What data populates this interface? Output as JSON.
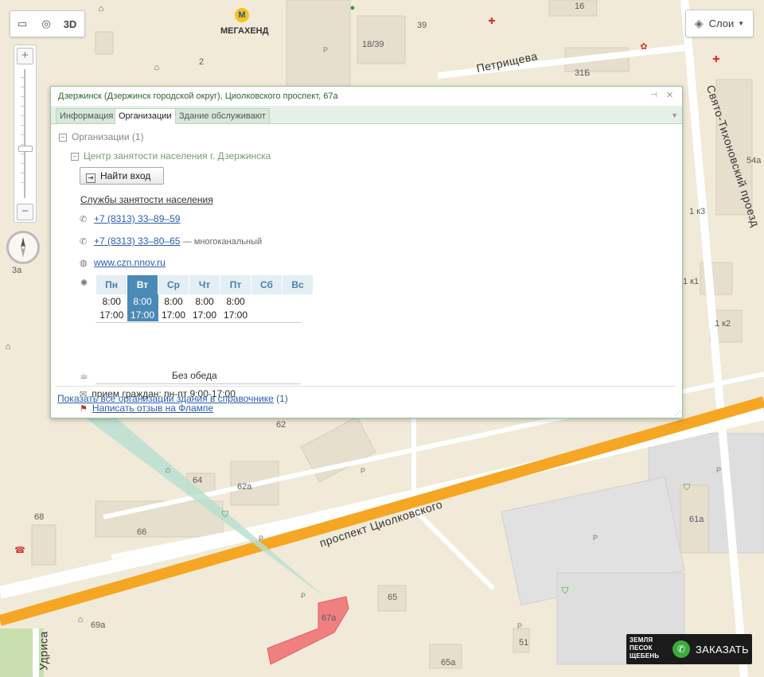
{
  "toolbar": {
    "ruler_icon": "ruler-icon",
    "radius_icon": "radius-icon",
    "label_3d": "3D"
  },
  "zoom": {
    "plus": "+",
    "minus": "−"
  },
  "layers": {
    "label": "Слои"
  },
  "map": {
    "streets": [
      {
        "name": "street-petrishcheva",
        "text": "Петрищева"
      },
      {
        "name": "street-svyato-tikhonovsky",
        "text": "Свято-Тихоновский проезд"
      },
      {
        "name": "street-tsiolkovsky",
        "text": "проспект Циолковского"
      },
      {
        "name": "street-udrisa",
        "text": "Удриса"
      }
    ],
    "poi_label": "МЕГАХЕНД",
    "house_numbers": [
      "16",
      "39",
      "18/39",
      "2",
      "31Б",
      "54а",
      "1 к3",
      "1 к1",
      "1 к2",
      "3а",
      "62",
      "64",
      "62а",
      "68",
      "66",
      "61а",
      "65",
      "67а",
      "69а",
      "51",
      "65а"
    ],
    "parking": "P"
  },
  "popup": {
    "title": "Дзержинск (Дзержинск городской округ), Циолковского проспект, 67а",
    "tabs": [
      {
        "label": "Информация"
      },
      {
        "label": "Организации"
      },
      {
        "label": "Здание обслуживают"
      }
    ],
    "tree_root": "Организации (1)",
    "org_name": "Центр занятости населения г. Дзержинска",
    "find_entrance": "Найти вход",
    "rubric": "Службы занятости населения",
    "phone1": "+7 (8313) 33–89–59",
    "phone2": "+7 (8313) 33–80–65",
    "phone2_comment": "— многоканальный",
    "website": "www.czn.nnov.ru",
    "hours": {
      "days": [
        "Пн",
        "Вт",
        "Ср",
        "Чт",
        "Пт",
        "Сб",
        "Вс"
      ],
      "today_index": 1,
      "open": [
        "8:00",
        "8:00",
        "8:00",
        "8:00",
        "8:00",
        "",
        ""
      ],
      "close": [
        "17:00",
        "17:00",
        "17:00",
        "17:00",
        "17:00",
        "",
        ""
      ]
    },
    "lunch": "Без обеда",
    "reception": "прием граждан: пн-пт 9:00-17:00",
    "flamp_link": "Написать отзыв на Флампе",
    "footer_link": "Показать все организации здания в справочнике",
    "footer_count": "(1)"
  },
  "ad": {
    "logo_lines": [
      "ЗЕМЛЯ",
      "ПЕСОК",
      "ЩЕБЕНЬ"
    ],
    "cta": "ЗАКАЗАТЬ"
  },
  "colors": {
    "map_bg": "#f3ecdc",
    "road_main": "#f5a623",
    "building": "#e9e2d0",
    "highlight": "#f08080",
    "popup_border": "#97c29f"
  }
}
